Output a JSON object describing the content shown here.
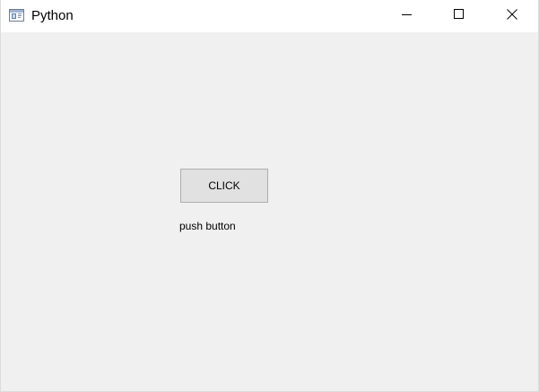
{
  "window": {
    "title": "Python",
    "icon": "python-window-icon"
  },
  "caption_buttons": {
    "minimize": "minimize-icon",
    "maximize": "maximize-icon",
    "close": "close-icon"
  },
  "content": {
    "button_label": "CLICK",
    "label_text": "push button"
  },
  "colors": {
    "titlebar_bg": "#ffffff",
    "client_bg": "#f0f0f0",
    "button_bg": "#e1e1e1",
    "button_border": "#adadad"
  }
}
